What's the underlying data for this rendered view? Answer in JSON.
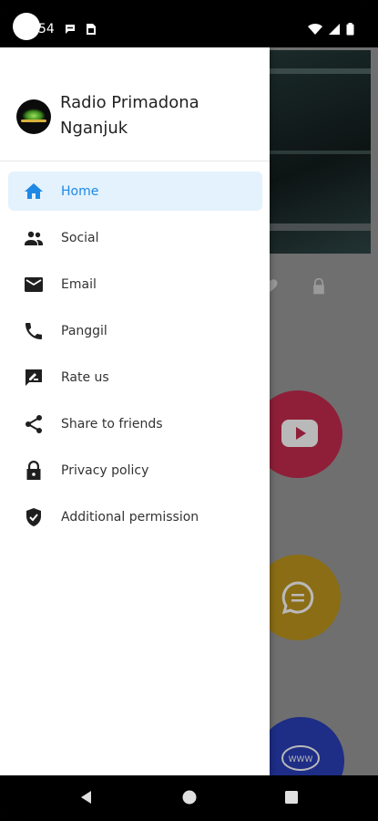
{
  "status_bar": {
    "time": "54",
    "icons": [
      "message-icon",
      "sim-icon",
      "wifi-icon",
      "signal-icon",
      "battery-icon"
    ]
  },
  "drawer": {
    "app_name": "Radio Primadona Nganjuk",
    "menu": [
      {
        "label": "Home",
        "icon": "home-icon",
        "active": true
      },
      {
        "label": "Social",
        "icon": "people-icon",
        "active": false
      },
      {
        "label": "Email",
        "icon": "mail-icon",
        "active": false
      },
      {
        "label": "Panggil",
        "icon": "phone-icon",
        "active": false
      },
      {
        "label": "Rate us",
        "icon": "rate-icon",
        "active": false
      },
      {
        "label": "Share to friends",
        "icon": "share-icon",
        "active": false
      },
      {
        "label": "Privacy policy",
        "icon": "lock-icon",
        "active": false
      },
      {
        "label": "Additional permission",
        "icon": "shield-check-icon",
        "active": false
      }
    ]
  },
  "background": {
    "buttons": [
      "youtube-icon",
      "chat-icon",
      "www-icon"
    ]
  },
  "nav_bar": {
    "buttons": [
      "back-icon",
      "home-nav-icon",
      "recents-icon"
    ]
  },
  "colors": {
    "accent": "#1e88e5",
    "active_bg": "#e3f2fd",
    "scrim": "#6f6f6f"
  }
}
